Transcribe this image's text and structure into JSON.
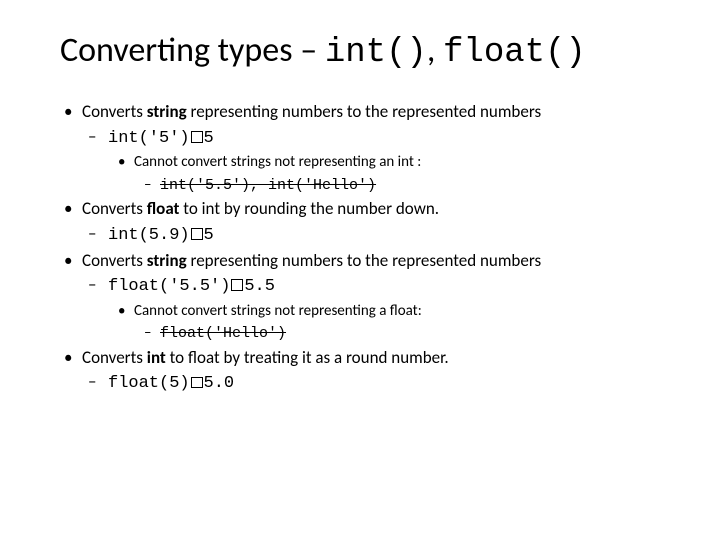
{
  "title": {
    "prefix": "Converting types – ",
    "code1": "int()",
    "sep": ", ",
    "code2": "float()"
  },
  "b1": {
    "pre": "Converts ",
    "bold": "string",
    "post": " representing numbers to the represented numbers"
  },
  "b1a": {
    "code": "int('5')",
    "result": "5"
  },
  "b1b": "Cannot  convert strings not representing an int :",
  "b1c": "int('5.5'), int('Hello')",
  "b2": {
    "pre": "Converts ",
    "bold": "float",
    "post": " to int by rounding the number down."
  },
  "b2a": {
    "code": "int(5.9)",
    "result": "5"
  },
  "b3": {
    "pre": "Converts ",
    "bold": "string",
    "post": " representing numbers to the represented numbers"
  },
  "b3a": {
    "code": "float('5.5')",
    "result": "5.5"
  },
  "b3b": "Cannot  convert strings not representing a float:",
  "b3c": "float('Hello')",
  "b4": {
    "pre": "Converts ",
    "bold": "int",
    "post": " to float by treating it as a round number."
  },
  "b4a": {
    "code": "float(5)",
    "result": "5.0"
  }
}
